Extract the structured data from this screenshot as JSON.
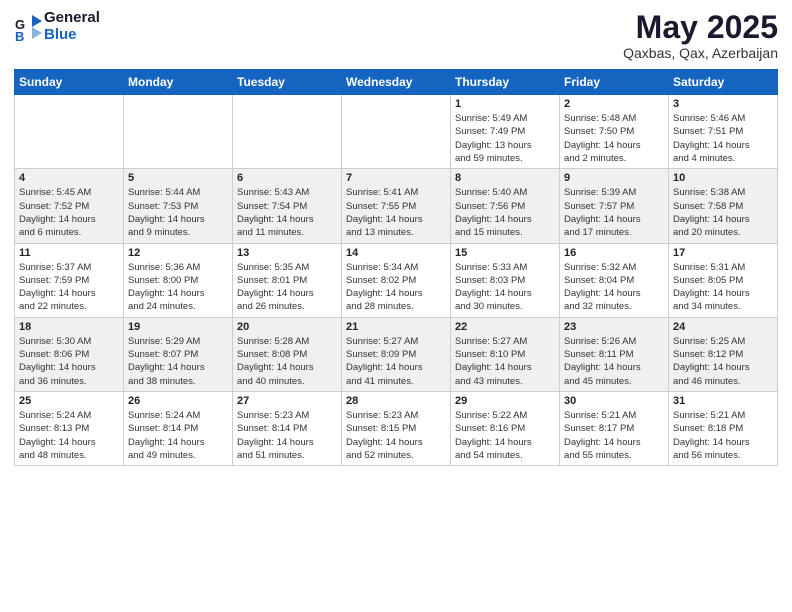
{
  "header": {
    "logo_line1": "General",
    "logo_line2": "Blue",
    "month": "May 2025",
    "location": "Qaxbas, Qax, Azerbaijan"
  },
  "weekdays": [
    "Sunday",
    "Monday",
    "Tuesday",
    "Wednesday",
    "Thursday",
    "Friday",
    "Saturday"
  ],
  "weeks": [
    [
      {
        "day": "",
        "info": ""
      },
      {
        "day": "",
        "info": ""
      },
      {
        "day": "",
        "info": ""
      },
      {
        "day": "",
        "info": ""
      },
      {
        "day": "1",
        "info": "Sunrise: 5:49 AM\nSunset: 7:49 PM\nDaylight: 13 hours\nand 59 minutes."
      },
      {
        "day": "2",
        "info": "Sunrise: 5:48 AM\nSunset: 7:50 PM\nDaylight: 14 hours\nand 2 minutes."
      },
      {
        "day": "3",
        "info": "Sunrise: 5:46 AM\nSunset: 7:51 PM\nDaylight: 14 hours\nand 4 minutes."
      }
    ],
    [
      {
        "day": "4",
        "info": "Sunrise: 5:45 AM\nSunset: 7:52 PM\nDaylight: 14 hours\nand 6 minutes."
      },
      {
        "day": "5",
        "info": "Sunrise: 5:44 AM\nSunset: 7:53 PM\nDaylight: 14 hours\nand 9 minutes."
      },
      {
        "day": "6",
        "info": "Sunrise: 5:43 AM\nSunset: 7:54 PM\nDaylight: 14 hours\nand 11 minutes."
      },
      {
        "day": "7",
        "info": "Sunrise: 5:41 AM\nSunset: 7:55 PM\nDaylight: 14 hours\nand 13 minutes."
      },
      {
        "day": "8",
        "info": "Sunrise: 5:40 AM\nSunset: 7:56 PM\nDaylight: 14 hours\nand 15 minutes."
      },
      {
        "day": "9",
        "info": "Sunrise: 5:39 AM\nSunset: 7:57 PM\nDaylight: 14 hours\nand 17 minutes."
      },
      {
        "day": "10",
        "info": "Sunrise: 5:38 AM\nSunset: 7:58 PM\nDaylight: 14 hours\nand 20 minutes."
      }
    ],
    [
      {
        "day": "11",
        "info": "Sunrise: 5:37 AM\nSunset: 7:59 PM\nDaylight: 14 hours\nand 22 minutes."
      },
      {
        "day": "12",
        "info": "Sunrise: 5:36 AM\nSunset: 8:00 PM\nDaylight: 14 hours\nand 24 minutes."
      },
      {
        "day": "13",
        "info": "Sunrise: 5:35 AM\nSunset: 8:01 PM\nDaylight: 14 hours\nand 26 minutes."
      },
      {
        "day": "14",
        "info": "Sunrise: 5:34 AM\nSunset: 8:02 PM\nDaylight: 14 hours\nand 28 minutes."
      },
      {
        "day": "15",
        "info": "Sunrise: 5:33 AM\nSunset: 8:03 PM\nDaylight: 14 hours\nand 30 minutes."
      },
      {
        "day": "16",
        "info": "Sunrise: 5:32 AM\nSunset: 8:04 PM\nDaylight: 14 hours\nand 32 minutes."
      },
      {
        "day": "17",
        "info": "Sunrise: 5:31 AM\nSunset: 8:05 PM\nDaylight: 14 hours\nand 34 minutes."
      }
    ],
    [
      {
        "day": "18",
        "info": "Sunrise: 5:30 AM\nSunset: 8:06 PM\nDaylight: 14 hours\nand 36 minutes."
      },
      {
        "day": "19",
        "info": "Sunrise: 5:29 AM\nSunset: 8:07 PM\nDaylight: 14 hours\nand 38 minutes."
      },
      {
        "day": "20",
        "info": "Sunrise: 5:28 AM\nSunset: 8:08 PM\nDaylight: 14 hours\nand 40 minutes."
      },
      {
        "day": "21",
        "info": "Sunrise: 5:27 AM\nSunset: 8:09 PM\nDaylight: 14 hours\nand 41 minutes."
      },
      {
        "day": "22",
        "info": "Sunrise: 5:27 AM\nSunset: 8:10 PM\nDaylight: 14 hours\nand 43 minutes."
      },
      {
        "day": "23",
        "info": "Sunrise: 5:26 AM\nSunset: 8:11 PM\nDaylight: 14 hours\nand 45 minutes."
      },
      {
        "day": "24",
        "info": "Sunrise: 5:25 AM\nSunset: 8:12 PM\nDaylight: 14 hours\nand 46 minutes."
      }
    ],
    [
      {
        "day": "25",
        "info": "Sunrise: 5:24 AM\nSunset: 8:13 PM\nDaylight: 14 hours\nand 48 minutes."
      },
      {
        "day": "26",
        "info": "Sunrise: 5:24 AM\nSunset: 8:14 PM\nDaylight: 14 hours\nand 49 minutes."
      },
      {
        "day": "27",
        "info": "Sunrise: 5:23 AM\nSunset: 8:14 PM\nDaylight: 14 hours\nand 51 minutes."
      },
      {
        "day": "28",
        "info": "Sunrise: 5:23 AM\nSunset: 8:15 PM\nDaylight: 14 hours\nand 52 minutes."
      },
      {
        "day": "29",
        "info": "Sunrise: 5:22 AM\nSunset: 8:16 PM\nDaylight: 14 hours\nand 54 minutes."
      },
      {
        "day": "30",
        "info": "Sunrise: 5:21 AM\nSunset: 8:17 PM\nDaylight: 14 hours\nand 55 minutes."
      },
      {
        "day": "31",
        "info": "Sunrise: 5:21 AM\nSunset: 8:18 PM\nDaylight: 14 hours\nand 56 minutes."
      }
    ]
  ]
}
